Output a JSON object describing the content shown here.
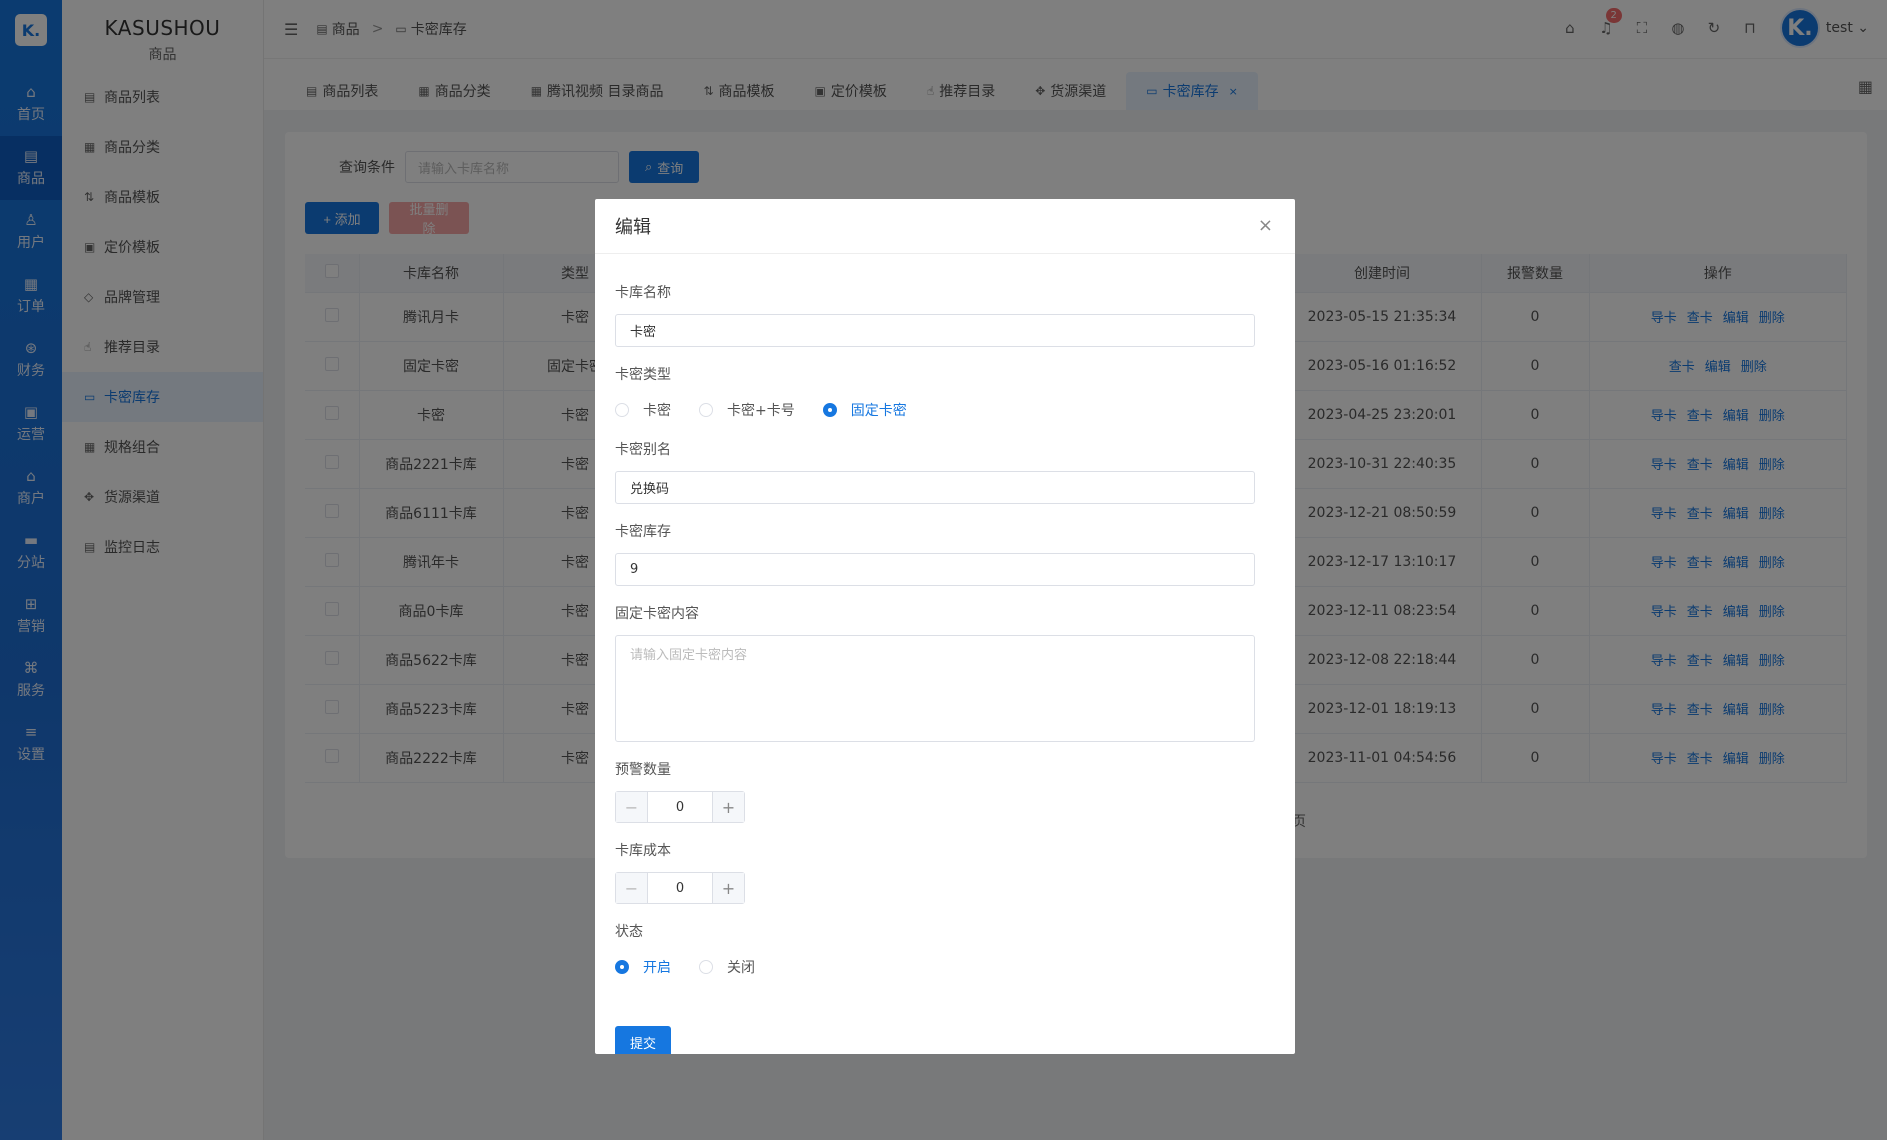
{
  "rail": {
    "logo": "K.",
    "items": [
      {
        "icon": "home-icon",
        "glyph": "⌂",
        "label": "首页"
      },
      {
        "icon": "goods-icon",
        "glyph": "▤",
        "label": "商品"
      },
      {
        "icon": "user-icon",
        "glyph": "♙",
        "label": "用户"
      },
      {
        "icon": "order-icon",
        "glyph": "▦",
        "label": "订单"
      },
      {
        "icon": "finance-icon",
        "glyph": "⊛",
        "label": "财务"
      },
      {
        "icon": "operation-icon",
        "glyph": "▣",
        "label": "运营"
      },
      {
        "icon": "merchant-icon",
        "glyph": "⌂",
        "label": "商户"
      },
      {
        "icon": "substation-icon",
        "glyph": "▬",
        "label": "分站"
      },
      {
        "icon": "marketing-icon",
        "glyph": "⊞",
        "label": "营销"
      },
      {
        "icon": "service-icon",
        "glyph": "⌘",
        "label": "服务"
      },
      {
        "icon": "settings-icon",
        "glyph": "≡",
        "label": "设置"
      }
    ]
  },
  "sidebar": {
    "brand": "KASUSHOU",
    "section": "商品",
    "items": [
      {
        "icon": "list-icon",
        "glyph": "▤",
        "label": "商品列表"
      },
      {
        "icon": "category-icon",
        "glyph": "▦",
        "label": "商品分类"
      },
      {
        "icon": "template-icon",
        "glyph": "⇅",
        "label": "商品模板"
      },
      {
        "icon": "pricing-icon",
        "glyph": "▣",
        "label": "定价模板"
      },
      {
        "icon": "tag-icon",
        "glyph": "◇",
        "label": "品牌管理"
      },
      {
        "icon": "thumb-icon",
        "glyph": "☝",
        "label": "推荐目录"
      },
      {
        "icon": "card-stock-icon",
        "glyph": "▭",
        "label": "卡密库存"
      },
      {
        "icon": "spec-icon",
        "glyph": "▦",
        "label": "规格组合"
      },
      {
        "icon": "channel-icon",
        "glyph": "✥",
        "label": "货源渠道"
      },
      {
        "icon": "log-icon",
        "glyph": "▤",
        "label": "监控日志"
      }
    ]
  },
  "header": {
    "crumb_parent": "商品",
    "crumb_current": "卡密库存",
    "notify_count": "2",
    "avatar_letter": "K.",
    "username": "test"
  },
  "tabs": [
    {
      "icon": "list-icon",
      "glyph": "▤",
      "label": "商品列表"
    },
    {
      "icon": "category-icon",
      "glyph": "▦",
      "label": "商品分类"
    },
    {
      "icon": "video-icon",
      "glyph": "▦",
      "label": "腾讯视频 目录商品"
    },
    {
      "icon": "template-icon",
      "glyph": "⇅",
      "label": "商品模板"
    },
    {
      "icon": "pricing-icon",
      "glyph": "▣",
      "label": "定价模板"
    },
    {
      "icon": "thumb-icon",
      "glyph": "☝",
      "label": "推荐目录"
    },
    {
      "icon": "channel-icon",
      "glyph": "✥",
      "label": "货源渠道"
    },
    {
      "icon": "card-stock-icon",
      "glyph": "▭",
      "label": "卡密库存",
      "active": true
    }
  ],
  "search": {
    "label": "查询条件",
    "placeholder": "请输入卡库名称",
    "button": "查询"
  },
  "actions": {
    "add": "+ 添加",
    "batch_delete": "批量删除"
  },
  "table": {
    "columns": [
      "卡库名称",
      "类型",
      "创建时间",
      "报警数量",
      "操作"
    ],
    "rows": [
      {
        "name": "腾讯月卡",
        "type": "卡密",
        "created": "2023-05-15 21:35:34",
        "alert": "0",
        "ops": [
          "导卡",
          "查卡",
          "编辑",
          "删除"
        ]
      },
      {
        "name": "固定卡密",
        "type": "固定卡密",
        "created": "2023-05-16 01:16:52",
        "alert": "0",
        "ops": [
          "查卡",
          "编辑",
          "删除"
        ]
      },
      {
        "name": "卡密",
        "type": "卡密",
        "created": "2023-04-25 23:20:01",
        "alert": "0",
        "ops": [
          "导卡",
          "查卡",
          "编辑",
          "删除"
        ]
      },
      {
        "name": "商品2221卡库",
        "type": "卡密",
        "created": "2023-10-31 22:40:35",
        "alert": "0",
        "ops": [
          "导卡",
          "查卡",
          "编辑",
          "删除"
        ]
      },
      {
        "name": "商品6111卡库",
        "type": "卡密",
        "created": "2023-12-21 08:50:59",
        "alert": "0",
        "ops": [
          "导卡",
          "查卡",
          "编辑",
          "删除"
        ]
      },
      {
        "name": "腾讯年卡",
        "type": "卡密",
        "created": "2023-12-17 13:10:17",
        "alert": "0",
        "ops": [
          "导卡",
          "查卡",
          "编辑",
          "删除"
        ]
      },
      {
        "name": "商品0卡库",
        "type": "卡密",
        "created": "2023-12-11 08:23:54",
        "alert": "0",
        "ops": [
          "导卡",
          "查卡",
          "编辑",
          "删除"
        ]
      },
      {
        "name": "商品5622卡库",
        "type": "卡密",
        "created": "2023-12-08 22:18:44",
        "alert": "0",
        "ops": [
          "导卡",
          "查卡",
          "编辑",
          "删除"
        ]
      },
      {
        "name": "商品5223卡库",
        "type": "卡密",
        "created": "2023-12-01 18:19:13",
        "alert": "0",
        "ops": [
          "导卡",
          "查卡",
          "编辑",
          "删除"
        ]
      },
      {
        "name": "商品2222卡库",
        "type": "卡密",
        "created": "2023-11-01 04:54:56",
        "alert": "0",
        "ops": [
          "导卡",
          "查卡",
          "编辑",
          "删除"
        ]
      }
    ],
    "pager_tail": "页"
  },
  "modal": {
    "title": "编辑",
    "name_label": "卡库名称",
    "name_value": "卡密",
    "type_label": "卡密类型",
    "type_options": [
      "卡密",
      "卡密+卡号",
      "固定卡密"
    ],
    "type_selected": 2,
    "alias_label": "卡密别名",
    "alias_value": "兑换码",
    "stock_label": "卡密库存",
    "stock_value": "9",
    "content_label": "固定卡密内容",
    "content_placeholder": "请输入固定卡密内容",
    "alert_label": "预警数量",
    "alert_value": "0",
    "cost_label": "卡库成本",
    "cost_value": "0",
    "status_label": "状态",
    "status_options": [
      "开启",
      "关闭"
    ],
    "status_selected": 0,
    "submit": "提交"
  },
  "colors": {
    "primary": "#1677e0",
    "danger_light": "#f6a7a7",
    "badge": "#f56c6c"
  }
}
